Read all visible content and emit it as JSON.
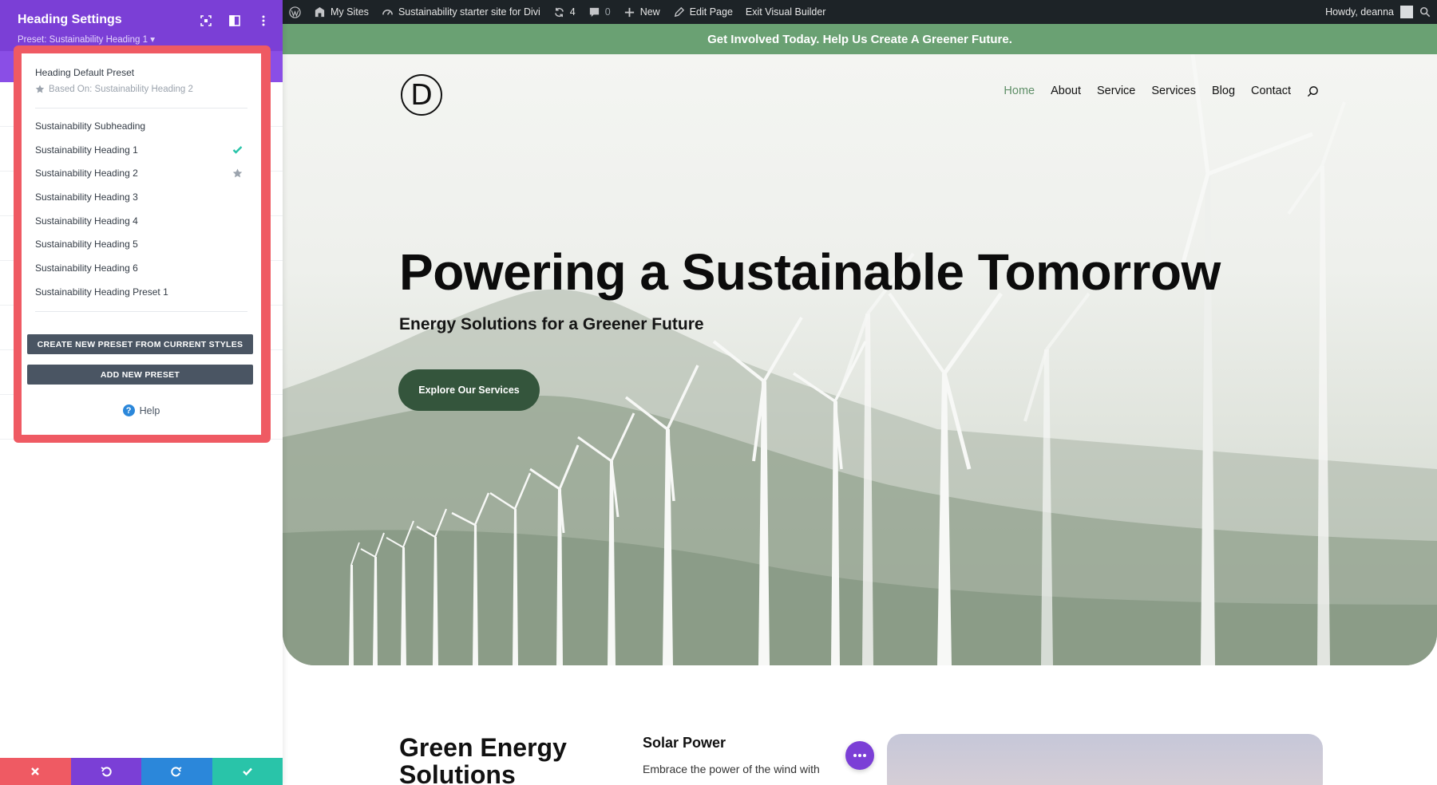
{
  "panel": {
    "title": "Heading Settings",
    "preset_label": "Preset: Sustainability Heading 1 ▾"
  },
  "preset_menu": {
    "default_name": "Heading Default Preset",
    "based_on": "Based On: Sustainability Heading 2",
    "items": [
      {
        "label": "Sustainability Subheading"
      },
      {
        "label": "Sustainability Heading 1",
        "state": "active"
      },
      {
        "label": "Sustainability Heading 2",
        "state": "default"
      },
      {
        "label": "Sustainability Heading 3"
      },
      {
        "label": "Sustainability Heading 4"
      },
      {
        "label": "Sustainability Heading 5"
      },
      {
        "label": "Sustainability Heading 6"
      },
      {
        "label": "Sustainability Heading Preset 1"
      }
    ],
    "create_button": "CREATE NEW PRESET FROM CURRENT STYLES",
    "add_button": "ADD NEW PRESET",
    "help": "Help",
    "help_symbol": "?"
  },
  "adminbar": {
    "my_sites": "My Sites",
    "site_name": "Sustainability starter site for Divi",
    "updates_count": "4",
    "comments_count": "0",
    "new": "New",
    "edit_page": "Edit Page",
    "exit_builder": "Exit Visual Builder",
    "howdy": "Howdy, deanna"
  },
  "site": {
    "topbar": "Get Involved Today. Help Us Create A Greener Future.",
    "logo_letter": "D",
    "nav": [
      "Home",
      "About",
      "Service",
      "Services",
      "Blog",
      "Contact"
    ],
    "hero_title": "Powering a Sustainable Tomorrow",
    "hero_subtitle": "Energy Solutions for a Greener Future",
    "hero_button": "Explore Our Services",
    "section_title": "Green Energy Solutions",
    "solar_title": "Solar Power",
    "solar_text": "Embrace the power of the wind with"
  },
  "colors": {
    "accent_purple": "#7b3fd6",
    "highlight_red": "#ef5a63",
    "topbar_green": "#6aa173",
    "button_green": "#34553c",
    "check_green": "#29c4a9"
  }
}
